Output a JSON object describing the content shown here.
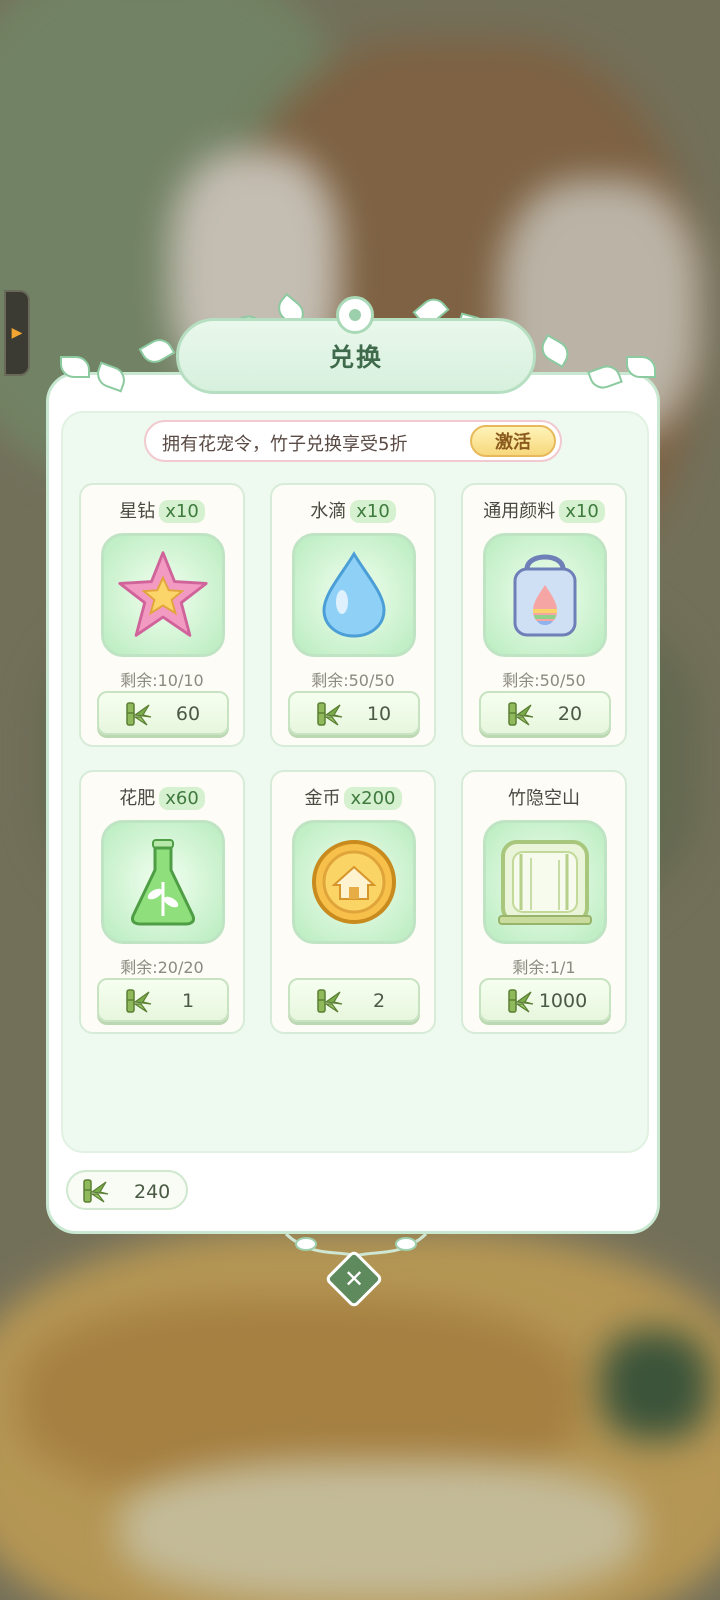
{
  "sidebar_tab": {
    "arrow": "▶"
  },
  "dialog": {
    "title": "兑换",
    "promo": {
      "text": "拥有花宠令，竹子兑换享受5折",
      "button_label": "激活"
    },
    "items": [
      {
        "name": "星钻",
        "qty": "x10",
        "icon": "star-icon",
        "remain": "剩余:10/10",
        "price": "60"
      },
      {
        "name": "水滴",
        "qty": "x10",
        "icon": "water-drop-icon",
        "remain": "剩余:50/50",
        "price": "10"
      },
      {
        "name": "通用颜料",
        "qty": "x10",
        "icon": "paint-bucket-icon",
        "remain": "剩余:50/50",
        "price": "20"
      },
      {
        "name": "花肥",
        "qty": "x60",
        "icon": "fertilizer-flask-icon",
        "remain": "剩余:20/20",
        "price": "1"
      },
      {
        "name": "金币",
        "qty": "x200",
        "icon": "gold-coin-icon",
        "remain": "",
        "price": "2"
      },
      {
        "name": "竹隐空山",
        "qty": "",
        "icon": "bamboo-frame-icon",
        "remain": "剩余:1/1",
        "price": "1000"
      }
    ],
    "wallet": {
      "currency_icon": "bamboo-icon",
      "amount": "240"
    },
    "close": {
      "glyph": "✕"
    }
  },
  "colors": {
    "panel_border": "#c9e8d2",
    "title_text": "#3f6a4b",
    "accent_green": "#d6f1cf",
    "close_button": "#5f8a5e",
    "promo_button": "#f7d87c"
  }
}
